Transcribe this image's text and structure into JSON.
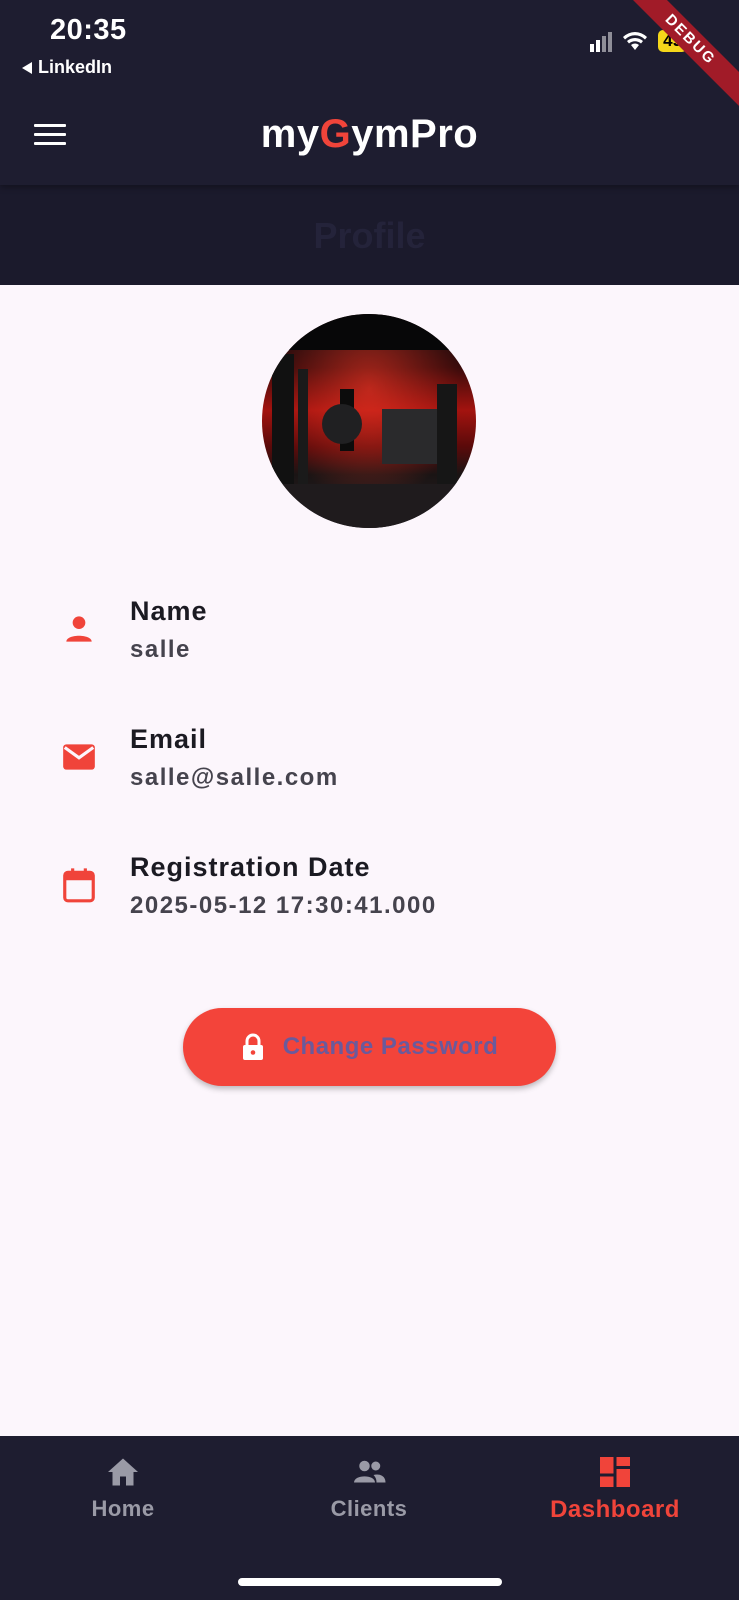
{
  "status_bar": {
    "time": "20:35",
    "back_app": "LinkedIn",
    "battery": "49",
    "debug_banner": "DEBUG"
  },
  "app_bar": {
    "title_prefix": "my",
    "title_accent": "G",
    "title_suffix": "ymPro",
    "accent_color": "#f0443a",
    "menu_icon": "menu-icon"
  },
  "page": {
    "title": "Profile"
  },
  "profile": {
    "fields": [
      {
        "icon": "person-icon",
        "label": "Name",
        "value": "salle"
      },
      {
        "icon": "email-icon",
        "label": "Email",
        "value": "salle@salle.com"
      },
      {
        "icon": "calendar-icon",
        "label": "Registration Date",
        "value": "2025-05-12 17:30:41.000"
      }
    ]
  },
  "actions": {
    "change_password_label": "Change Password",
    "change_password_icon": "lock-icon"
  },
  "bottom_nav": {
    "items": [
      {
        "label": "Home",
        "icon": "home-icon",
        "active": false
      },
      {
        "label": "Clients",
        "icon": "group-icon",
        "active": false
      },
      {
        "label": "Dashboard",
        "icon": "dashboard-icon",
        "active": true
      }
    ]
  }
}
